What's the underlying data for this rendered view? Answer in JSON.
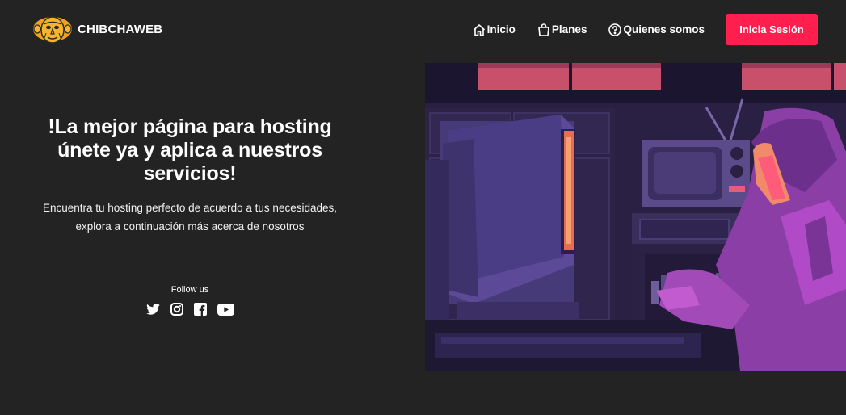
{
  "brand": {
    "name": "CHIBCHAWEB",
    "logo_icon": "monkey-logo-icon"
  },
  "nav": {
    "items": [
      {
        "label": "Inicio",
        "icon": "home-icon"
      },
      {
        "label": "Planes",
        "icon": "shopping-bag-icon"
      },
      {
        "label": "Quienes somos",
        "icon": "question-circle-icon"
      }
    ],
    "login_label": "Inicia Sesión"
  },
  "hero": {
    "title_lines": [
      "!La mejor página para hosting",
      "únete ya y aplica a nuestros",
      "servicios!"
    ],
    "subtitle_lines": [
      "Encuentra tu hosting perfecto de acuerdo a tus necesidades,",
      "explora a continuación más acerca de nosotros"
    ]
  },
  "social": {
    "label": "Follow us",
    "icons": [
      "twitter-icon",
      "instagram-icon",
      "facebook-icon",
      "youtube-icon"
    ]
  },
  "colors": {
    "background": "#232323",
    "accent": "#ff1f4f",
    "text": "#ffffff"
  }
}
